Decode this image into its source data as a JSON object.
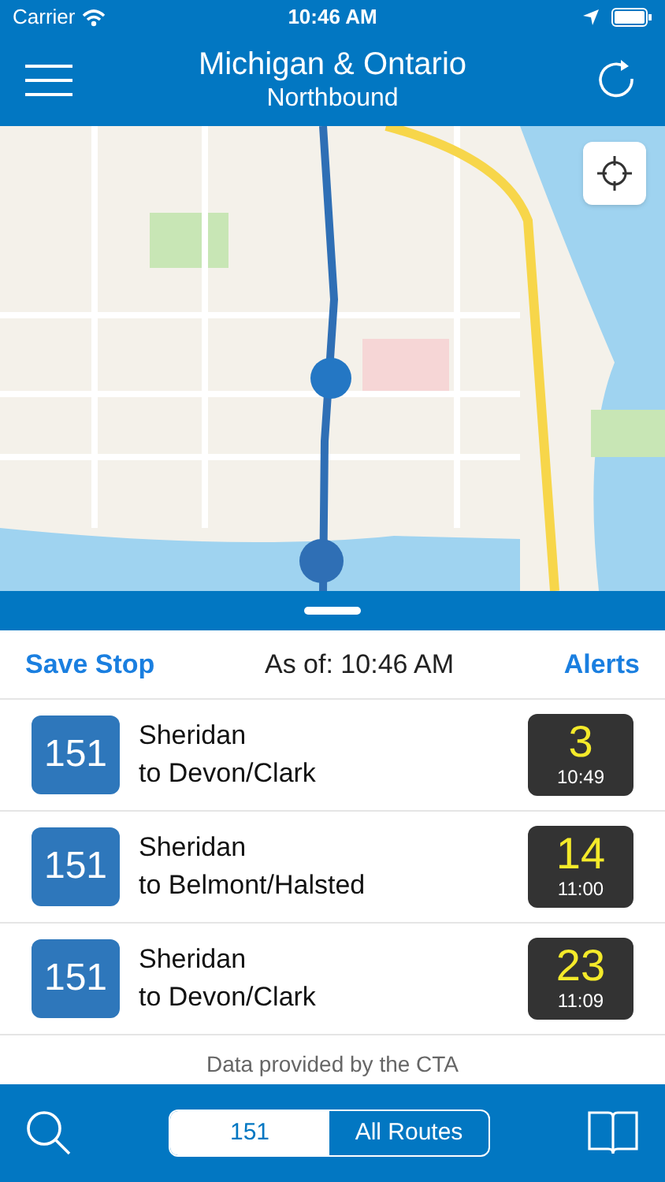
{
  "status_bar": {
    "carrier": "Carrier",
    "time": "10:46 AM"
  },
  "header": {
    "title": "Michigan & Ontario",
    "subtitle": "Northbound"
  },
  "toolbar": {
    "save": "Save Stop",
    "as_of": "As of: 10:46 AM",
    "alerts": "Alerts"
  },
  "arrivals": [
    {
      "route": "151",
      "name": "Sheridan",
      "destination": "to Devon/Clark",
      "minutes": "3",
      "time": "10:49"
    },
    {
      "route": "151",
      "name": "Sheridan",
      "destination": "to Belmont/Halsted",
      "minutes": "14",
      "time": "11:00"
    },
    {
      "route": "151",
      "name": "Sheridan",
      "destination": "to Devon/Clark",
      "minutes": "23",
      "time": "11:09"
    }
  ],
  "footer": "Data provided by the CTA",
  "segments": [
    {
      "label": "151",
      "selected": true
    },
    {
      "label": "All Routes",
      "selected": false
    }
  ]
}
